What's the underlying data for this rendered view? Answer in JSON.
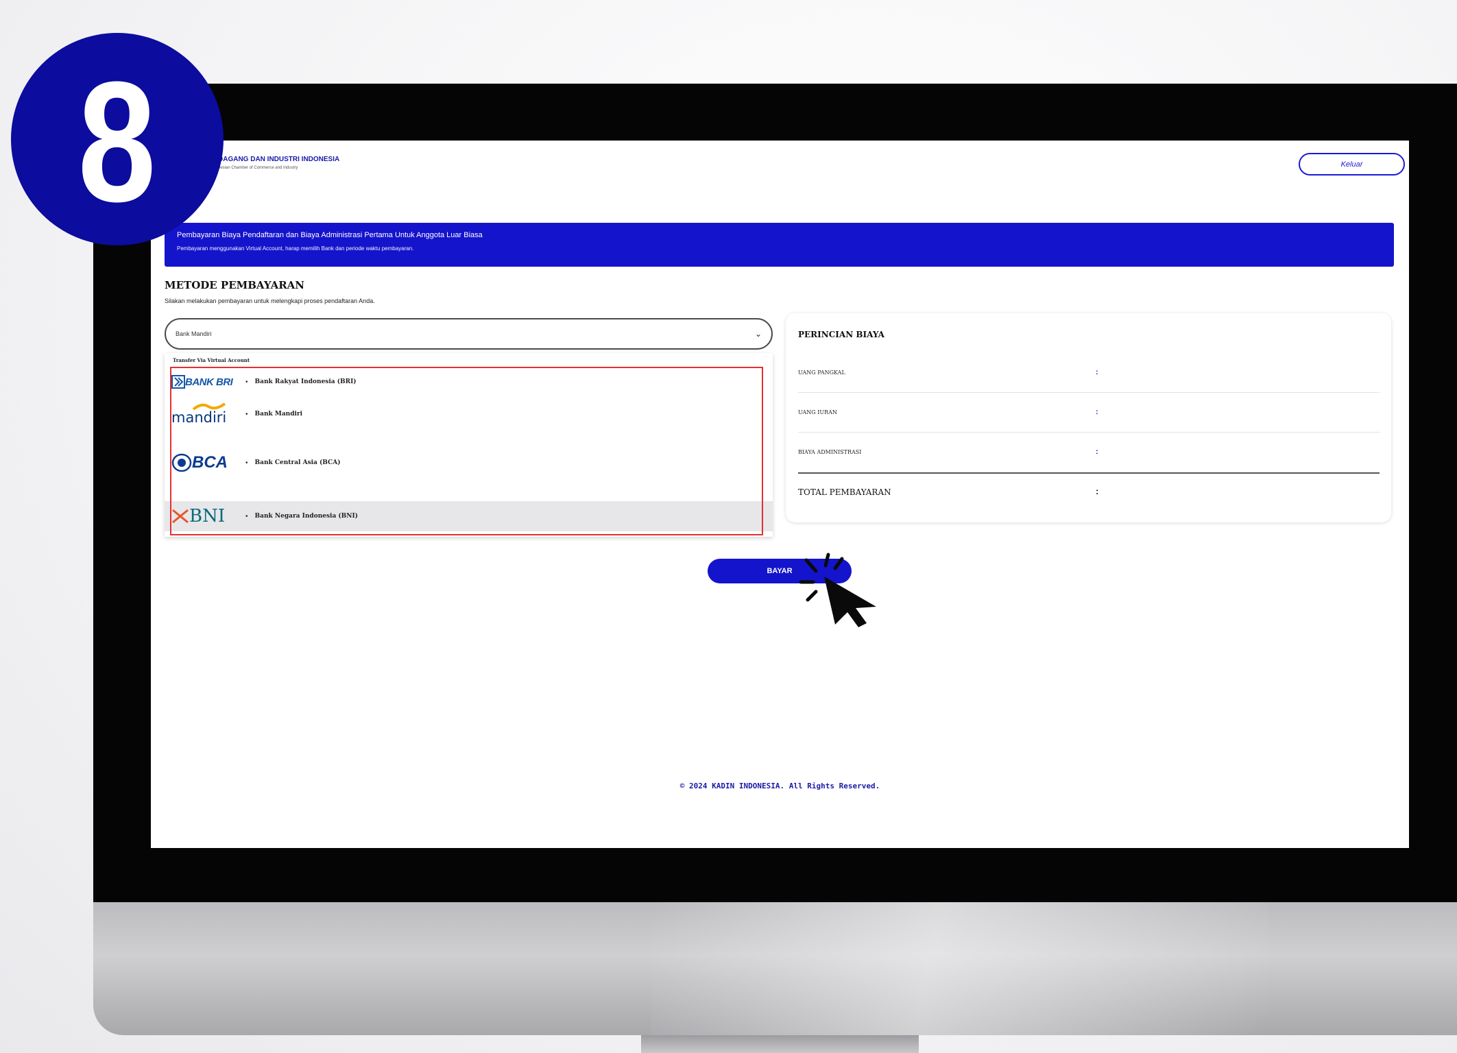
{
  "step": {
    "number": "8"
  },
  "header": {
    "org_name": "DAGANG DAN INDUSTRI INDONESIA",
    "org_sub": "nesian Chamber of Commerce and Industry",
    "logout_label": "Keluar"
  },
  "banner": {
    "title": "Pembayaran Biaya Pendaftaran dan Biaya Administrasi Pertama Untuk Anggota Luar Biasa",
    "subtitle": "Pembayaran menggunakan Virtual Account, harap memilih Bank dan periode waktu pembayaran."
  },
  "payment": {
    "title": "METODE PEMBAYARAN",
    "subtitle": "Silakan melakukan pembayaran untuk melengkapi proses pendaftaran Anda.",
    "selected_bank": "Bank Mandiri",
    "group_label": "Transfer Via Virtual Account",
    "options": [
      {
        "logo_text": "BANK BRI",
        "label": "Bank Rakyat Indonesia (BRI)"
      },
      {
        "logo_text": "mandiri",
        "label": "Bank Mandiri"
      },
      {
        "logo_text": "BCA",
        "label": "Bank Central Asia (BCA)"
      },
      {
        "logo_text": "BNI",
        "label": "Bank Negara Indonesia (BNI)"
      }
    ]
  },
  "fees": {
    "title": "PERINCIAN BIAYA",
    "rows": [
      {
        "label": "UANG PANGKAL",
        "sep": ":"
      },
      {
        "label": "UANG IURAN",
        "sep": ":"
      },
      {
        "label": "BIAYA ADMINISTRASI",
        "sep": ":"
      }
    ],
    "total_label": "TOTAL PEMBAYARAN",
    "total_sep": ":"
  },
  "pay_button": {
    "label": "BAYAR"
  },
  "footer": {
    "text": "© 2024 KADIN INDONESIA. All Rights Reserved."
  },
  "colors": {
    "primary": "#1414cc",
    "highlight_box": "#e52f2f",
    "badge": "#0c0c9e"
  }
}
